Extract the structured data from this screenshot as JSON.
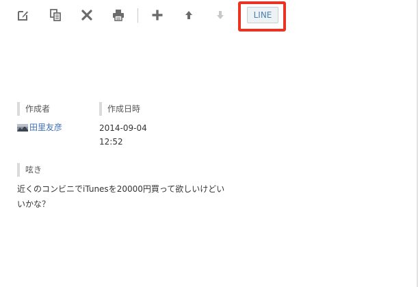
{
  "toolbar": {
    "buttons": [
      {
        "icon": "edit-icon"
      },
      {
        "icon": "copy-icon"
      },
      {
        "icon": "delete-icon"
      },
      {
        "icon": "print-icon"
      },
      {
        "icon": "add-icon"
      },
      {
        "icon": "arrow-up-icon"
      },
      {
        "icon": "arrow-down-icon"
      }
    ],
    "line_label": "LINE",
    "highlight_color": "#ea3423"
  },
  "fields": {
    "author_label": "作成者",
    "author_name": "田里友彦",
    "created_label": "作成日時",
    "created_date": "2014-09-04",
    "created_time": "12:52",
    "tweet_label": "呟き",
    "tweet_text": "近くのコンビニでiTunesを20000円買って欲しいけどいいかな？"
  },
  "colors": {
    "link": "#3b6fb6",
    "icon": "#6b6b6b",
    "icon_disabled": "#c8c8c8"
  }
}
